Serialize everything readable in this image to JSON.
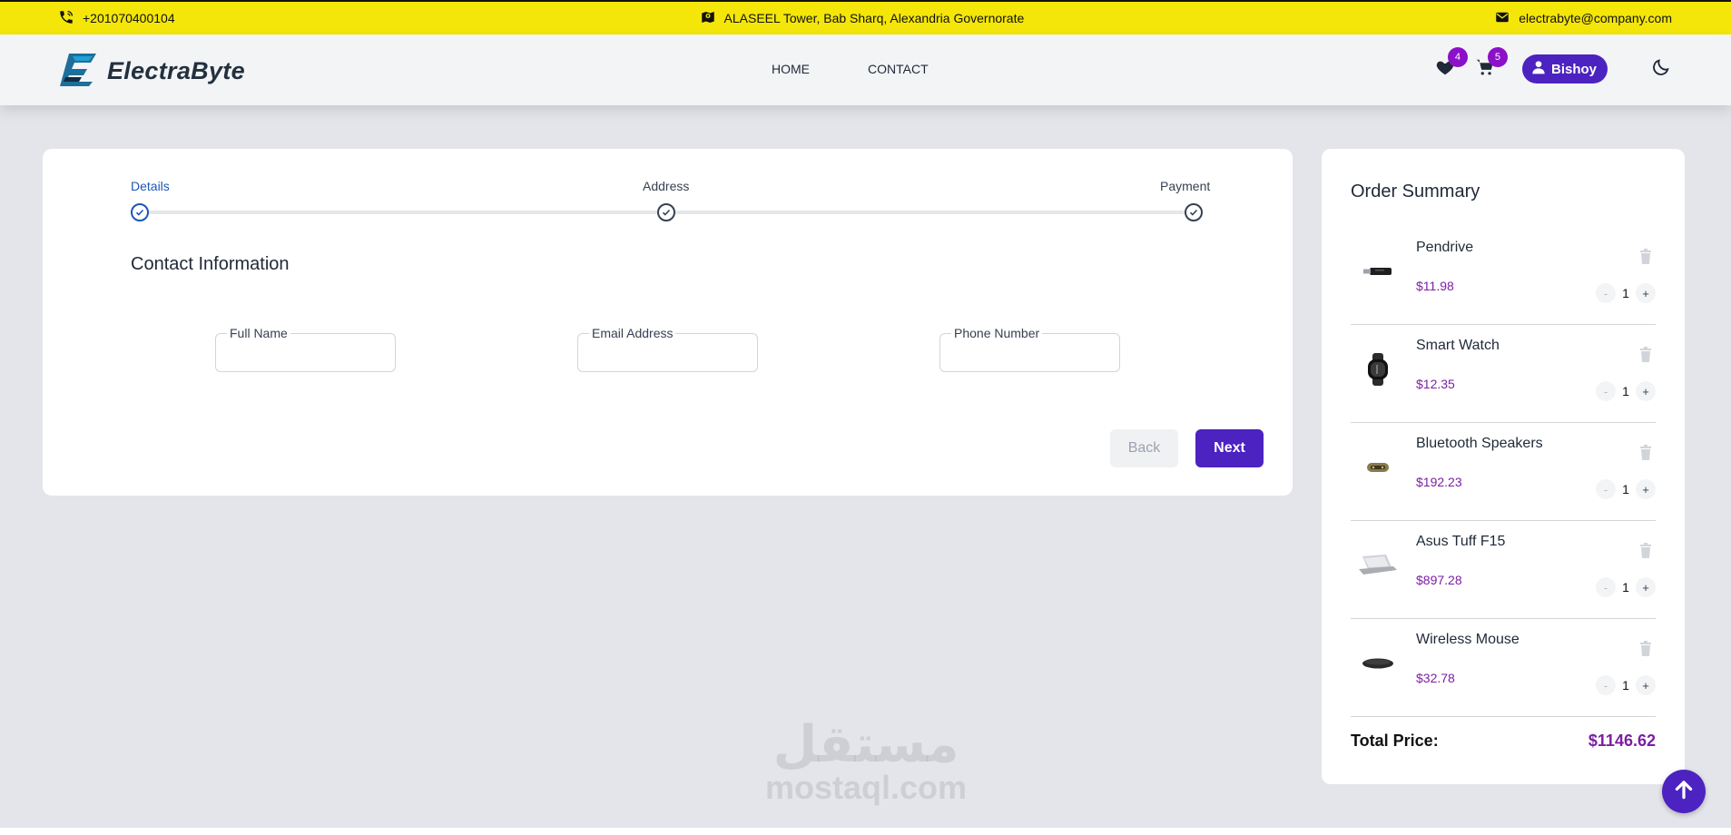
{
  "topbar": {
    "phone": "+201070400104",
    "address": "ALASEEL Tower, Bab Sharq, Alexandria Governorate",
    "email": "electrabyte@company.com"
  },
  "navbar": {
    "brand": "ElectraByte",
    "links": [
      "HOME",
      "CONTACT"
    ],
    "wishlist_count": "4",
    "cart_count": "5",
    "user_name": "Bishoy"
  },
  "stepper": {
    "steps": [
      "Details",
      "Address",
      "Payment"
    ],
    "active_step": "Details"
  },
  "form": {
    "title": "Contact Information",
    "fields": [
      {
        "label": "Full Name",
        "value": ""
      },
      {
        "label": "Email Address",
        "value": ""
      },
      {
        "label": "Phone Number",
        "value": ""
      }
    ],
    "back_label": "Back",
    "next_label": "Next"
  },
  "summary": {
    "title": "Order Summary",
    "items": [
      {
        "name": "Pendrive",
        "price": "$11.98",
        "qty": "1",
        "icon": "pendrive"
      },
      {
        "name": "Smart Watch",
        "price": "$12.35",
        "qty": "1",
        "icon": "smartwatch"
      },
      {
        "name": "Bluetooth Speakers",
        "price": "$192.23",
        "qty": "1",
        "icon": "speaker"
      },
      {
        "name": "Asus Tuff F15",
        "price": "$897.28",
        "qty": "1",
        "icon": "laptop"
      },
      {
        "name": "Wireless Mouse",
        "price": "$32.78",
        "qty": "1",
        "icon": "mouse"
      }
    ],
    "qty_minus": "-",
    "qty_plus": "+",
    "total_label": "Total Price:",
    "total_value": "$1146.62"
  },
  "watermark": {
    "arabic": "مستقل",
    "latin": "mostaql.com"
  },
  "colors": {
    "topbar": "#f4e609",
    "primary": "#4c22c0",
    "badge": "#8b10c8",
    "price": "#7b1fa2",
    "active_step": "#1e56b5"
  }
}
